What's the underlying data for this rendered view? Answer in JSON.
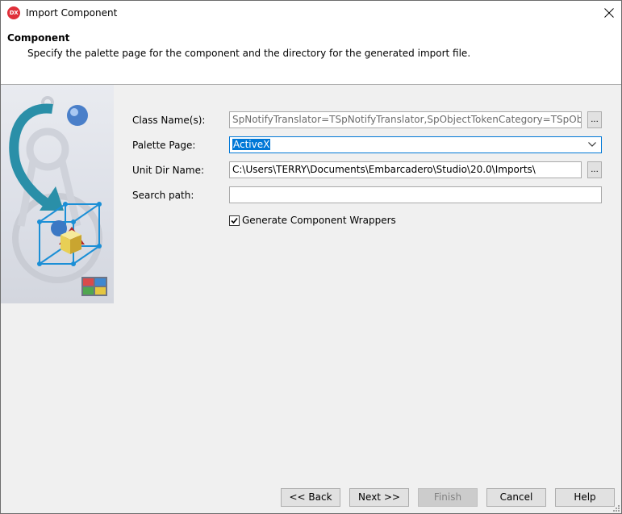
{
  "window": {
    "title": "Import Component",
    "icon_text": "DX",
    "close_icon": "close-icon"
  },
  "header": {
    "title": "Component",
    "description": "Specify the palette page for the component and the directory for the generated import file."
  },
  "form": {
    "class_names": {
      "label": "Class Name(s):",
      "value": "SpNotifyTranslator=TSpNotifyTranslator,SpObjectTokenCategory=TSpObjectToken",
      "browse_label": "..."
    },
    "palette_page": {
      "label": "Palette Page:",
      "value": "ActiveX"
    },
    "unit_dir": {
      "label": "Unit Dir Name:",
      "value": "C:\\Users\\TERRY\\Documents\\Embarcadero\\Studio\\20.0\\Imports\\",
      "browse_label": "..."
    },
    "search_path": {
      "label": "Search path:",
      "value": ""
    },
    "generate_wrappers": {
      "label": "Generate Component Wrappers",
      "checked": true
    }
  },
  "buttons": {
    "back": "<< Back",
    "next": "Next >>",
    "finish": "Finish",
    "cancel": "Cancel",
    "help": "Help"
  },
  "colors": {
    "accent": "#0078d7",
    "logo": "#e0303a"
  }
}
